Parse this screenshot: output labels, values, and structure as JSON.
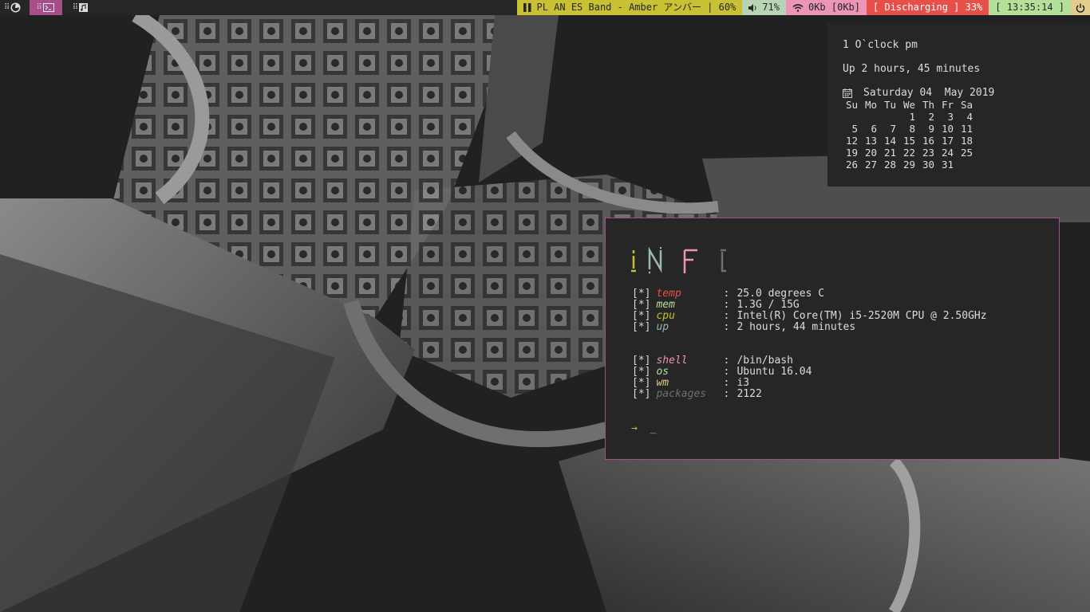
{
  "topbar": {
    "workspaces": [
      {
        "name": "firefox",
        "icon": "firefox-icon",
        "active": false
      },
      {
        "name": "terminal",
        "icon": "terminal-icon",
        "active": true
      },
      {
        "name": "music",
        "icon": "music-note-icon",
        "active": false
      }
    ],
    "music": {
      "icon": "pause-icon",
      "text": "PL AN ES Band - Amber アンバー | 60%"
    },
    "volume": {
      "icon": "speaker-icon",
      "text": "71%"
    },
    "network": {
      "icon": "wifi-icon",
      "text": "0Kb [0Kb]"
    },
    "battery": {
      "text": "[ Discharging ] 33%"
    },
    "clock": {
      "text": "[ 13:35:14 ]"
    },
    "power": {
      "icon": "power-icon"
    },
    "colors": {
      "music": "#c8c133",
      "volume": "#b9d3b5",
      "network": "#ec95b6",
      "battery": "#e7504a",
      "clock": "#b5e09a",
      "power": "#e2cd8f",
      "active_workspace": "#a64d8a"
    }
  },
  "calendar_widget": {
    "time_words": "1 O`clock pm",
    "uptime": "Up 2 hours, 45 minutes",
    "date_icon": "calendar-icon",
    "date": "Saturday 04  May 2019",
    "weekdays": [
      "Su",
      "Mo",
      "Tu",
      "We",
      "Th",
      "Fr",
      "Sa"
    ],
    "weeks": [
      [
        "",
        "",
        "",
        "1",
        "2",
        "3",
        "4"
      ],
      [
        "5",
        "6",
        "7",
        "8",
        "9",
        "10",
        "11"
      ],
      [
        "12",
        "13",
        "14",
        "15",
        "16",
        "17",
        "18"
      ],
      [
        "19",
        "20",
        "21",
        "22",
        "23",
        "24",
        "25"
      ],
      [
        "26",
        "27",
        "28",
        "29",
        "30",
        "31",
        ""
      ]
    ]
  },
  "terminal": {
    "logo_letters": [
      {
        "char": "I",
        "color": "#c8c133"
      },
      {
        "char": "N",
        "color": "#9ab9ad"
      },
      {
        "char": "F",
        "color": "#ec95b6"
      },
      {
        "char": "O",
        "color": "#6f6f6f"
      }
    ],
    "bracket": "[*]",
    "sysinfo": [
      {
        "key": "temp",
        "value": "25.0 degrees C",
        "color": "#e7504a"
      },
      {
        "key": "mem",
        "value": "1.3G / 15G",
        "color": "#b5e09a"
      },
      {
        "key": "cpu",
        "value": "Intel(R) Core(TM) i5-2520M CPU @ 2.50GHz",
        "color": "#c8c133"
      },
      {
        "key": "up",
        "value": "2 hours, 44 minutes",
        "color": "#9ab9ad"
      }
    ],
    "envinfo": [
      {
        "key": "shell",
        "value": "/bin/bash",
        "color": "#ec95b6"
      },
      {
        "key": "os",
        "value": "Ubuntu 16.04",
        "color": "#b5e09a"
      },
      {
        "key": "wm",
        "value": "i3",
        "color": "#e2cd8f"
      },
      {
        "key": "packages",
        "value": "2122",
        "color": "#6f6f6f"
      }
    ],
    "separator": ":",
    "prompt_symbol": "→",
    "cursor": "_",
    "border_color": "#a64d8a"
  }
}
